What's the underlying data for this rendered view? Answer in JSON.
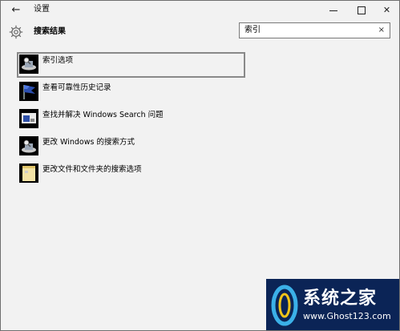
{
  "window": {
    "title": "设置",
    "back_glyph": "←",
    "minimize_label": "",
    "close_glyph": "✕"
  },
  "header": {
    "title": "搜索结果",
    "icon": "gear-icon"
  },
  "search": {
    "value": "索引",
    "clear_glyph": "×"
  },
  "results": [
    {
      "label": "索引选项",
      "icon": "indexing-options-icon",
      "selected": true
    },
    {
      "label": "查看可靠性历史记录",
      "icon": "reliability-flag-icon",
      "selected": false
    },
    {
      "label": "查找并解决 Windows Search 问题",
      "icon": "troubleshoot-icon",
      "selected": false
    },
    {
      "label": "更改 Windows 的搜索方式",
      "icon": "search-settings-icon",
      "selected": false
    },
    {
      "label": "更改文件和文件夹的搜索选项",
      "icon": "folder-options-icon",
      "selected": false
    }
  ],
  "watermark": {
    "title": "系统之家",
    "url": "www.Ghost123.com"
  },
  "colors": {
    "background": "#f2f2f2",
    "selection_border": "#898989",
    "watermark_bg": "#0b2456"
  }
}
